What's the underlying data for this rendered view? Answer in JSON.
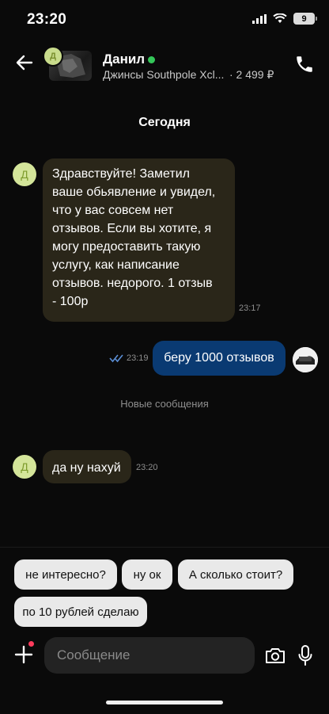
{
  "status_bar": {
    "time": "23:20",
    "battery": "9"
  },
  "header": {
    "contact_name": "Данил",
    "listing_title": "Джинсы Southpole Xcl...",
    "listing_price": "· 2 499 ₽",
    "avatar_letter": "Д"
  },
  "chat": {
    "date_label": "Сегодня",
    "messages": [
      {
        "text": "Здравствуйте! Заметил ваше обьявление и увидел, что у вас совсем нет отзывов. Если вы хотите, я могу предоставить такую услугу, как написание отзывов. недорого. 1 отзыв - 100р",
        "time": "23:17",
        "avatar": "Д"
      },
      {
        "text": "беру 1000 отзывов",
        "time": "23:19"
      },
      {
        "text": "да ну нахуй",
        "time": "23:20",
        "avatar": "Д"
      }
    ],
    "new_messages_label": "Новые сообщения"
  },
  "quick_replies": [
    "не интересно?",
    "ну ок",
    "А сколько стоит?",
    "по 10 рублей сделаю"
  ],
  "composer": {
    "placeholder": "Сообщение"
  },
  "colors": {
    "incoming_bubble": "#2a2619",
    "outgoing_bubble": "#0a3a72",
    "online": "#34c759",
    "avatar_bg": "#d4e59a"
  }
}
